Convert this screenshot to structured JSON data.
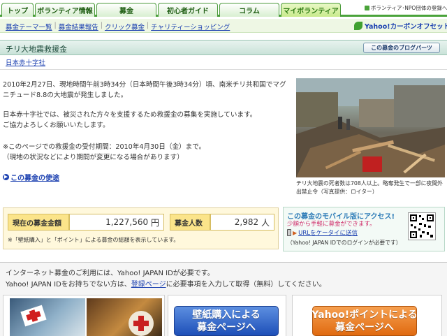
{
  "nav": {
    "tabs": [
      {
        "label": "トップ"
      },
      {
        "label": "ボランティア情報"
      },
      {
        "label": "募金"
      },
      {
        "label": "初心者ガイド"
      },
      {
        "label": "コラム"
      },
      {
        "label": "マイボランティア"
      }
    ],
    "register_link": "ボランティア･NPO団体の登録へ"
  },
  "subnav": {
    "links": [
      "募金テーマ一覧",
      "募金結果報告",
      "クリック募金",
      "チャリティーショッピング"
    ],
    "carbon_offset": "Yahoo!カーボンオフセット"
  },
  "campaign": {
    "title": "チリ大地震救援金",
    "blog_button": "この募金のブログパーツ",
    "organization": "日本赤十字社",
    "paragraph1_line1": "2010年2月27日、現地時間午前3時34分（日本時間午後3時34分）頃、南米チリ共和国でマグ",
    "paragraph1_line2": "ニチュード8.8の大地震が発生しました。",
    "paragraph2_line1": "日本赤十字社では、被災された方々を支援するため救援金の募集を実施しています。",
    "paragraph2_line2": "ご協力よろしくお願いいたします。",
    "paragraph3_line1": "※このページでの救援金の受付期間：2010年4月30日（金）まで。",
    "paragraph3_line2": "（現地の状況などにより期間が変更になる場合があります）",
    "purpose_link": "この募金の使途",
    "photo_caption": "チリ大地震の死者数は708人以上。略奪発生で一部に夜間外出禁止令（写真提供：ロイター）"
  },
  "donation": {
    "amount_label": "現在の募金金額",
    "amount_value": "1,227,560",
    "amount_unit": "円",
    "people_label": "募金人数",
    "people_value": "2,982",
    "people_unit": "人",
    "note": "※「壁紙購入」と「ポイント」による募金の総額を表示しています。"
  },
  "mobile": {
    "title": "この募金のモバイル版にアクセス!",
    "subtitle": "少額から手軽に募金ができます。",
    "link": "URLをケータイに送信",
    "note": "（Yahoo! JAPAN IDでのログインが必要です）"
  },
  "id_notice": {
    "line1": "インターネット募金のご利用には、Yahoo! JAPAN IDが必要です。",
    "line2_before": "Yahoo! JAPAN IDをお持ちでない方は、",
    "line2_link": "登録ページ",
    "line2_after": "に必要事項を入力して取得（無料）してください。"
  },
  "buttons": {
    "wallpaper_line1": "壁紙購入による",
    "wallpaper_line2": "募金ページへ",
    "points_line1": "Yahoo!ポイントによる",
    "points_line2": "募金ページへ"
  }
}
